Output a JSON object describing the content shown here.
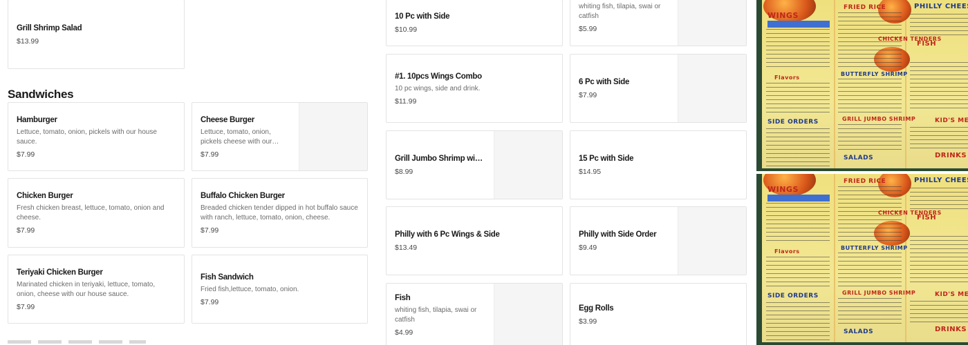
{
  "salads": {
    "grill_shrimp_salad": {
      "name": "Grill Shrimp Salad",
      "price": "$13.99"
    }
  },
  "sandwiches": {
    "title": "Sandwiches",
    "items": [
      {
        "name": "Hamburger",
        "desc": "Lettuce, tomato, onion, pickels with our house sauce.",
        "price": "$7.99"
      },
      {
        "name": "Cheese Burger",
        "desc": "Lettuce, tomato, onion, pickels cheese with our house sauce.",
        "price": "$7.99"
      },
      {
        "name": "Chicken Burger",
        "desc": "Fresh chicken breast, lettuce, tomato, onion and cheese.",
        "price": "$7.99"
      },
      {
        "name": "Buffalo Chicken Burger",
        "desc": "Breaded chicken tender dipped in hot buffalo sauce with ranch, lettuce, tomato, onion, cheese.",
        "price": "$7.99"
      },
      {
        "name": "Teriyaki Chicken Burger",
        "desc": "Marinated chicken in teriyaki, lettuce, tomato, onion, cheese with our house sauce.",
        "price": "$7.99"
      },
      {
        "name": "Fish Sandwich",
        "desc": "Fried fish,lettuce, tomato, onion.",
        "price": "$7.99"
      }
    ]
  },
  "combos": [
    {
      "name": "10 Pc with Side",
      "desc": "",
      "price": "$10.99"
    },
    {
      "name": "",
      "desc": "whiting fish, tilapia, swai or catfish",
      "price": "$5.99"
    },
    {
      "name": "#1. 10pcs Wings Combo",
      "desc": "10 pc wings, side and drink.",
      "price": "$11.99"
    },
    {
      "name": "6 Pc with Side",
      "desc": "",
      "price": "$7.99"
    },
    {
      "name": "Grill Jumbo Shrimp with Side",
      "desc": "",
      "price": "$8.99"
    },
    {
      "name": "15 Pc with Side",
      "desc": "",
      "price": "$14.95"
    },
    {
      "name": "Philly with 6 Pc Wings & Side",
      "desc": "",
      "price": "$13.49"
    },
    {
      "name": "Philly with Side Order",
      "desc": "",
      "price": "$9.49"
    },
    {
      "name": "Fish",
      "desc": "whiting fish, tilapia, swai or catfish",
      "price": "$4.99"
    },
    {
      "name": "Egg Rolls",
      "desc": "",
      "price": "$3.99"
    }
  ],
  "menu_photo": {
    "labels": [
      "WINGS",
      "FRIED RICE",
      "PHILLY CHEESE",
      "CHICKEN TENDERS",
      "Flavors",
      "BUTTERFLY SHRIMP",
      "FISH",
      "GRILL JUMBO SHRIMP",
      "SIDE ORDERS",
      "SALADS",
      "KID'S ME",
      "DRINKS"
    ]
  }
}
